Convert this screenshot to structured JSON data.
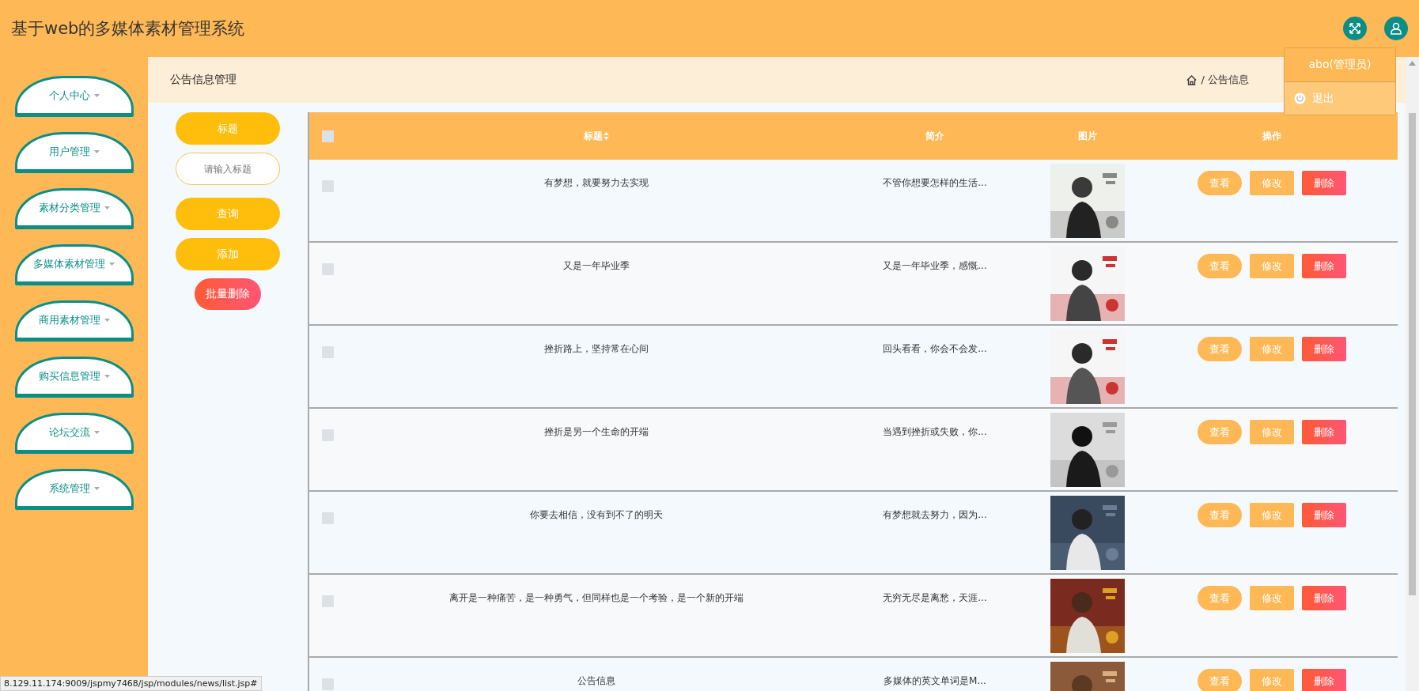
{
  "header": {
    "title": "基于web的多媒体素材管理系统"
  },
  "user_menu": {
    "user": "abo(管理员)",
    "items": [
      {
        "label": "退出",
        "highlighted": true
      }
    ]
  },
  "sidebar": {
    "items": [
      {
        "label": "个人中心"
      },
      {
        "label": "用户管理"
      },
      {
        "label": "素材分类管理"
      },
      {
        "label": "多媒体素材管理"
      },
      {
        "label": "商用素材管理"
      },
      {
        "label": "购买信息管理"
      },
      {
        "label": "论坛交流"
      },
      {
        "label": "系统管理"
      }
    ]
  },
  "page_title": "公告信息管理",
  "breadcrumb": "/ 公告信息",
  "search": {
    "field_label": "标题",
    "placeholder": "请输入标题",
    "buttons": [
      {
        "label": "查询",
        "kind": "primary"
      },
      {
        "label": "添加",
        "kind": "primary"
      },
      {
        "label": "批量删除",
        "kind": "danger"
      }
    ]
  },
  "table": {
    "header_checked": false,
    "columns": [
      {
        "label": "标题",
        "sortable": true
      },
      {
        "label": "简介",
        "sortable": false
      },
      {
        "label": "图片",
        "sortable": false
      },
      {
        "label": "操作",
        "sortable": false
      }
    ],
    "rows": [
      {
        "checked": false,
        "title": "有梦想，就要努力去实现",
        "intro": "不管你想要怎样的生活...",
        "image": {
          "kind": "picture"
        },
        "actions": [
          {
            "label": "查看",
            "kind": "view"
          },
          {
            "label": "修改",
            "kind": "edit"
          },
          {
            "label": "删除",
            "kind": "delete"
          }
        ]
      },
      {
        "checked": false,
        "title": "又是一年毕业季",
        "intro": "又是一年毕业季，感慨...",
        "image": {
          "kind": "picture"
        },
        "actions": [
          {
            "label": "查看",
            "kind": "view"
          },
          {
            "label": "修改",
            "kind": "edit"
          },
          {
            "label": "删除",
            "kind": "delete"
          }
        ]
      },
      {
        "checked": false,
        "title": "挫折路上，坚持常在心间",
        "intro": "回头看看，你会不会发...",
        "image": {
          "kind": "picture"
        },
        "actions": [
          {
            "label": "查看",
            "kind": "view"
          },
          {
            "label": "修改",
            "kind": "edit"
          },
          {
            "label": "删除",
            "kind": "delete"
          }
        ]
      },
      {
        "checked": false,
        "title": "挫折是另一个生命的开端",
        "intro": "当遇到挫折或失败，你...",
        "image": {
          "kind": "picture"
        },
        "actions": [
          {
            "label": "查看",
            "kind": "view"
          },
          {
            "label": "修改",
            "kind": "edit"
          },
          {
            "label": "删除",
            "kind": "delete"
          }
        ]
      },
      {
        "checked": false,
        "title": "你要去相信，没有到不了的明天",
        "intro": "有梦想就去努力，因为...",
        "image": {
          "kind": "picture"
        },
        "actions": [
          {
            "label": "查看",
            "kind": "view"
          },
          {
            "label": "修改",
            "kind": "edit"
          },
          {
            "label": "删除",
            "kind": "delete"
          }
        ]
      },
      {
        "checked": false,
        "title": "离开是一种痛苦，是一种勇气，但同样也是一个考验，是一个新的开端",
        "intro": "无穷无尽是离愁，天涯...",
        "image": {
          "kind": "picture"
        },
        "actions": [
          {
            "label": "查看",
            "kind": "view"
          },
          {
            "label": "修改",
            "kind": "edit"
          },
          {
            "label": "删除",
            "kind": "delete"
          }
        ]
      },
      {
        "checked": false,
        "title": "公告信息",
        "intro": "多媒体的英文单词是M...",
        "image": {
          "kind": "picture"
        },
        "actions": [
          {
            "label": "查看",
            "kind": "view"
          },
          {
            "label": "修改",
            "kind": "edit"
          },
          {
            "label": "删除",
            "kind": "delete"
          }
        ]
      }
    ]
  },
  "status_bar": {
    "url": "8.129.11.174:9009/jspmy7468/jsp/modules/news/list.jsp#"
  }
}
